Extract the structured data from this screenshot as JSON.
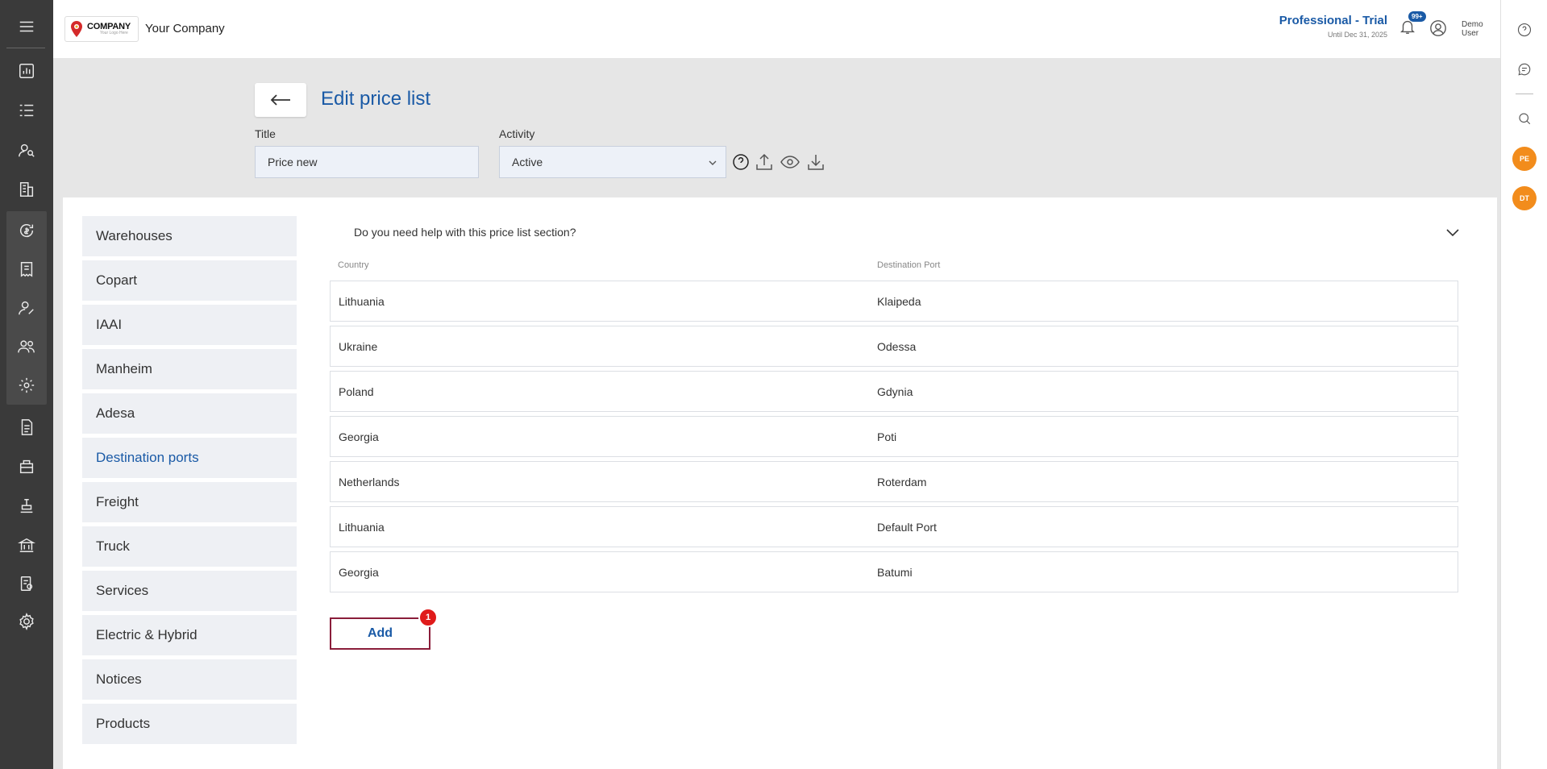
{
  "header": {
    "logo": {
      "name": "COMPANY",
      "tagline": "Your Logo Here"
    },
    "company_name": "Your Company",
    "plan": {
      "name": "Professional - Trial",
      "until": "Until Dec 31, 2025"
    },
    "notifications_badge": "99+",
    "user_name": "Demo User"
  },
  "left_rail": {
    "icons": [
      "menu-icon",
      "dashboard-icon",
      "checklist-icon",
      "users-search-icon",
      "building-icon",
      "money-cycle-icon",
      "receipt-icon",
      "user-edit-icon",
      "users-icon",
      "gear-users-icon",
      "document-icon",
      "box-icon",
      "stamp-icon",
      "bank-icon",
      "document-settings-icon",
      "settings-icon"
    ]
  },
  "right_rail": {
    "icons": [
      "help-icon",
      "chat-icon",
      "search-icon"
    ],
    "avatars": [
      "PE",
      "DT"
    ]
  },
  "page": {
    "title": "Edit price list",
    "title_label": "Title",
    "title_value": "Price new",
    "activity_label": "Activity",
    "activity_value": "Active"
  },
  "sidebar": {
    "items": [
      {
        "label": "Warehouses",
        "active": false
      },
      {
        "label": "Copart",
        "active": false
      },
      {
        "label": "IAAI",
        "active": false
      },
      {
        "label": "Manheim",
        "active": false
      },
      {
        "label": "Adesa",
        "active": false
      },
      {
        "label": "Destination ports",
        "active": true
      },
      {
        "label": "Freight",
        "active": false
      },
      {
        "label": "Truck",
        "active": false
      },
      {
        "label": "Services",
        "active": false
      },
      {
        "label": "Electric & Hybrid",
        "active": false
      },
      {
        "label": "Notices",
        "active": false
      },
      {
        "label": "Products",
        "active": false
      }
    ]
  },
  "main": {
    "help_text": "Do you need help with this price list section?",
    "columns": [
      "Country",
      "Destination Port"
    ],
    "rows": [
      {
        "country": "Lithuania",
        "port": "Klaipeda"
      },
      {
        "country": "Ukraine",
        "port": "Odessa"
      },
      {
        "country": "Poland",
        "port": "Gdynia"
      },
      {
        "country": "Georgia",
        "port": "Poti"
      },
      {
        "country": "Netherlands",
        "port": "Roterdam"
      },
      {
        "country": "Lithuania",
        "port": "Default Port"
      },
      {
        "country": "Georgia",
        "port": "Batumi"
      }
    ],
    "add_label": "Add",
    "add_badge": "1"
  }
}
